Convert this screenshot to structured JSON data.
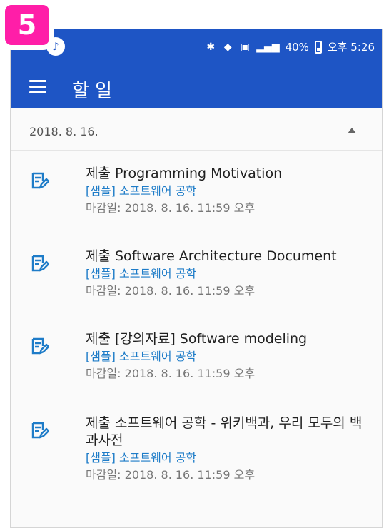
{
  "badge": {
    "label": "5"
  },
  "status_bar": {
    "left_icon": "headphones-icon",
    "bluetooth_icon": "bluetooth-icon",
    "wifi_icon": "wifi-icon",
    "data_icon": "mobile-data-icon",
    "signal_icon": "signal-icon",
    "battery_text": "40%",
    "battery_icon": "battery-icon",
    "time_text": "오후 5:26"
  },
  "app_bar": {
    "menu_icon": "menu-icon",
    "title": "할 일"
  },
  "date_group": {
    "date_label": "2018. 8. 16.",
    "toggle_icon": "chevron-up-icon"
  },
  "items": [
    {
      "icon": "assignment-edit-icon",
      "title": "제출 Programming Motivation",
      "course": "[샘플] 소프트웨어 공학",
      "due": "마감일: 2018. 8. 16. 11:59 오후"
    },
    {
      "icon": "assignment-edit-icon",
      "title": "제출 Software Architecture Document",
      "course": "[샘플] 소프트웨어 공학",
      "due": "마감일: 2018. 8. 16. 11:59 오후"
    },
    {
      "icon": "assignment-edit-icon",
      "title": "제출 [강의자료] Software modeling",
      "course": "[샘플] 소프트웨어 공학",
      "due": "마감일: 2018. 8. 16. 11:59 오후"
    },
    {
      "icon": "assignment-edit-icon",
      "title": "제출 소프트웨어 공학 - 위키백과, 우리 모두의 백과사전",
      "course": "[샘플] 소프트웨어 공학",
      "due": "마감일: 2018. 8. 16. 11:59 오후"
    }
  ],
  "colors": {
    "primary": "#1e55c5",
    "badge": "#ff1ea8",
    "course": "#1e7cc8",
    "title_text": "#202020",
    "secondary_text": "#777777"
  }
}
